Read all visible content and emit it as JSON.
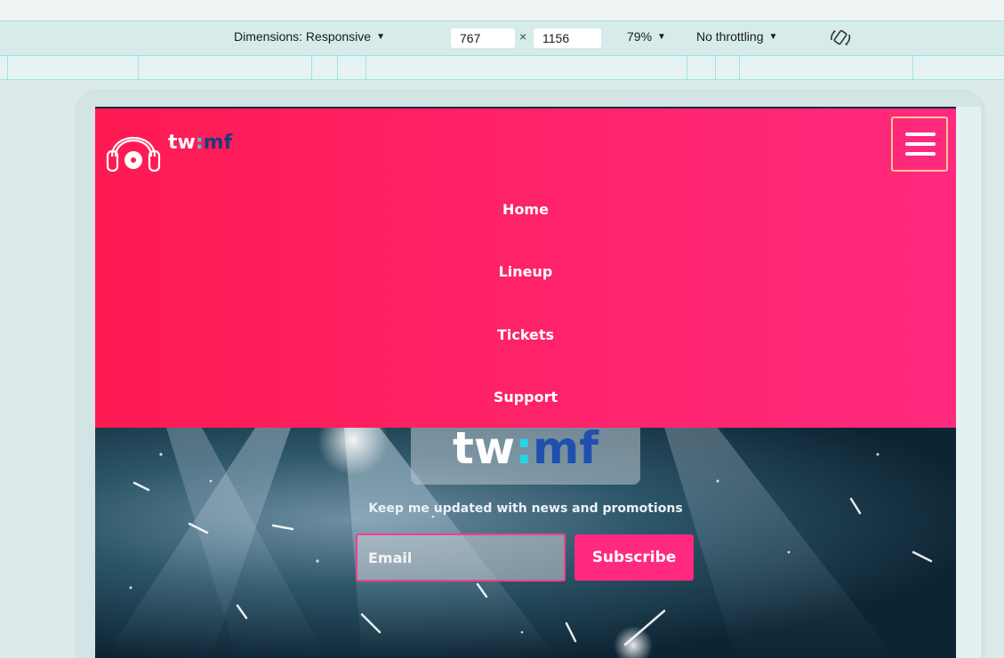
{
  "devtools": {
    "dimensions_label": "Dimensions: Responsive",
    "width_value": "767",
    "times_sign": "×",
    "height_value": "1156",
    "zoom_label": "79%",
    "throttling_label": "No throttling",
    "caret": "▼",
    "rotate_icon": "rotate-icon"
  },
  "site": {
    "brand": {
      "part1": "tw",
      "colon": ":",
      "part2": "mf"
    },
    "nav_items": [
      {
        "label": "Home"
      },
      {
        "label": "Lineup"
      },
      {
        "label": "Tickets"
      },
      {
        "label": "Support"
      }
    ],
    "hero": {
      "logo": {
        "part1": "tw",
        "colon": ":",
        "part2": "mf"
      },
      "tagline": "Keep me updated with news and promotions",
      "email_placeholder": "Email",
      "subscribe_label": "Subscribe"
    }
  },
  "colors": {
    "nav_gradient_start": "#fe1a52",
    "nav_gradient_end": "#ff2a7f",
    "accent_pink": "#ff2a7f",
    "brand_cyan": "#2fd3e2",
    "brand_navy": "#223a7a",
    "hamburger_border": "#ffc68f"
  }
}
